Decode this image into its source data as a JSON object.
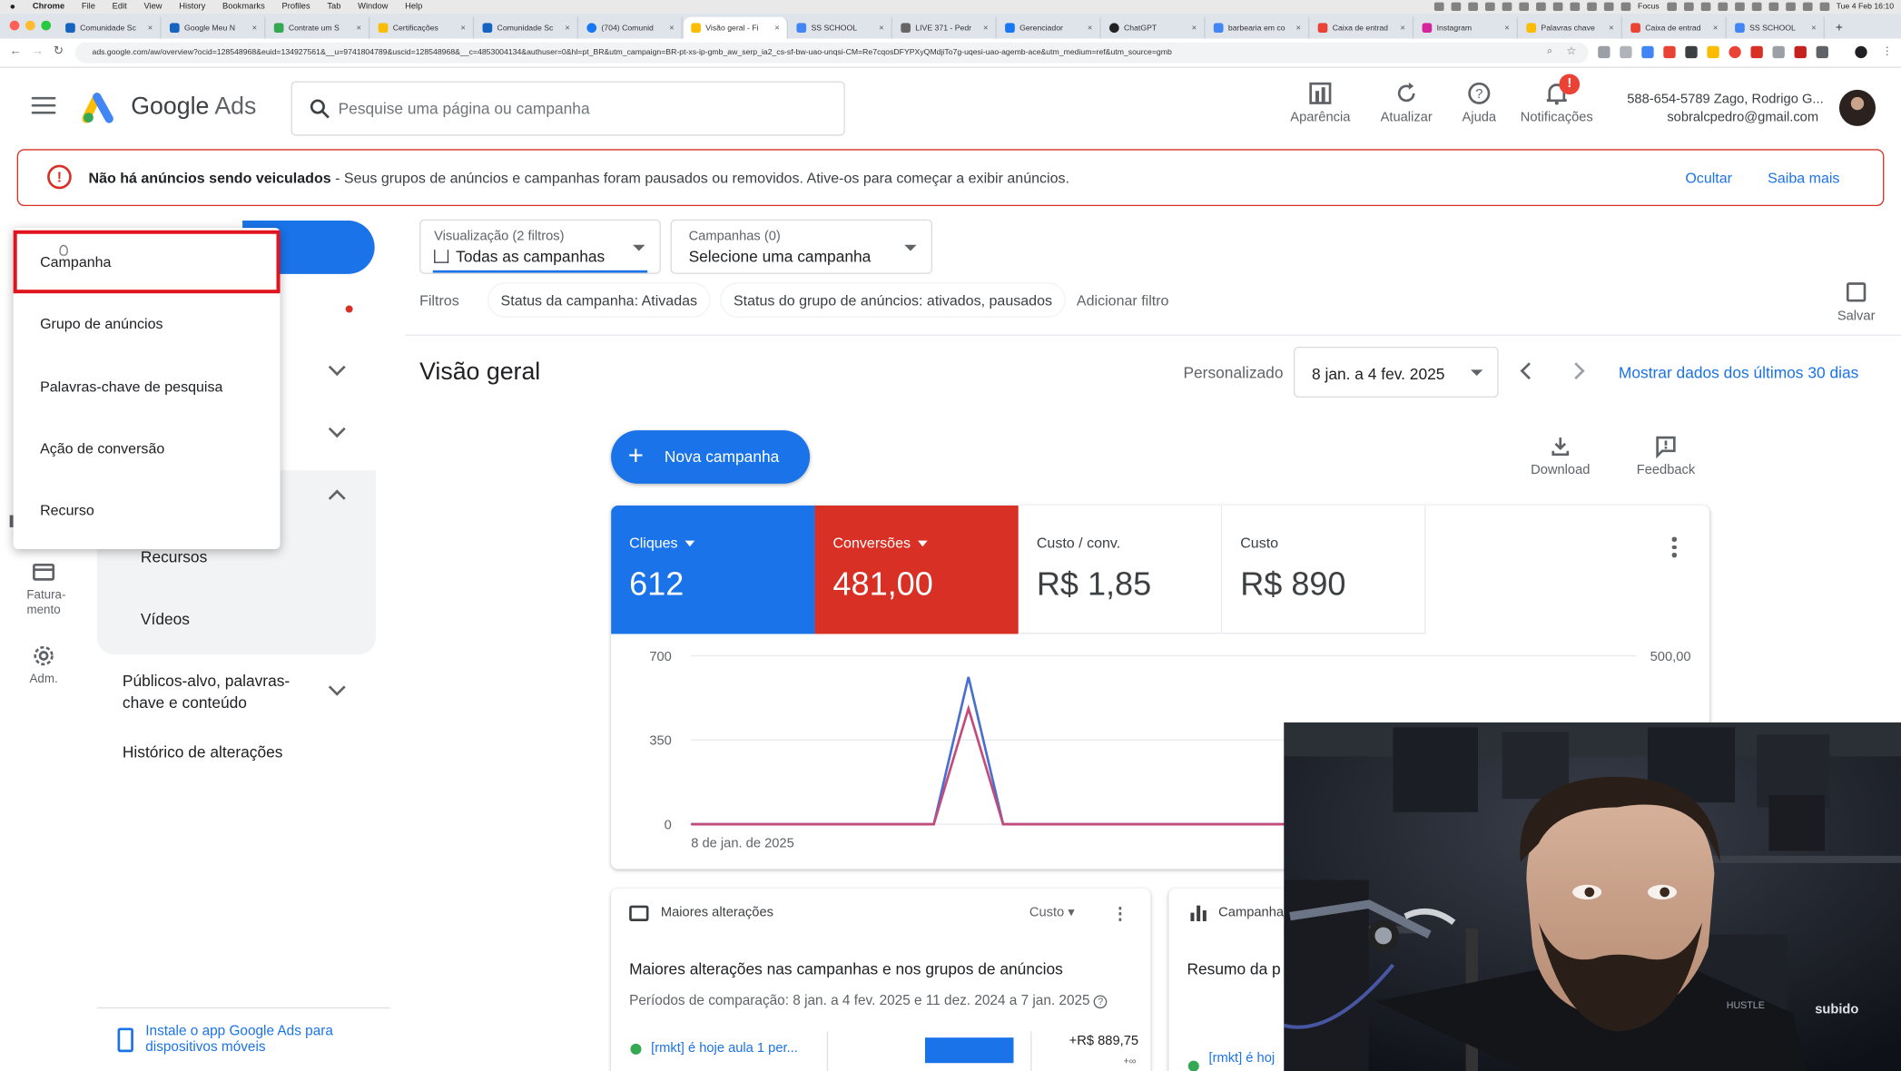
{
  "mac": {
    "menu": [
      "Chrome",
      "File",
      "Edit",
      "View",
      "History",
      "Bookmarks",
      "Profiles",
      "Tab",
      "Window",
      "Help"
    ],
    "right_items": [
      "Focus",
      "Tue 4 Feb 16:10"
    ]
  },
  "browser": {
    "tabs": [
      "Comunidade Sc",
      "Google Meu N",
      "Contrate um S",
      "Certificações",
      "Comunidade Sc",
      "(704) Comunid",
      "Visão geral - Fi",
      "SS SCHOOL",
      "LIVE 371 - Pedr",
      "Gerenciador",
      "ChatGPT",
      "barbearia em co",
      "Caixa de entrad",
      "Instagram",
      "Palavras chave",
      "Caixa de entrad",
      "SS SCHOOL"
    ],
    "url": "ads.google.com/aw/overview?ocid=128548968&euid=134927561&__u=9741804789&uscid=128548968&__c=4853004134&authuser=0&hl=pt_BR&utm_campaign=BR-pt-xs-ip-gmb_aw_serp_ia2_cs-sf-bw-uao-unqsi-CM=Re7cqosDFYPXyQMdjiTo7g-uqesi-uao-agemb-ace&utm_medium=ref&utm_source=gmb"
  },
  "header": {
    "brand_google": "Google",
    "brand_ads": "Ads",
    "search_placeholder": "Pesquise uma página ou campanha",
    "buttons": {
      "appearance": "Aparência",
      "refresh": "Atualizar",
      "help": "Ajuda",
      "notifications": "Notificações"
    },
    "notification_badge": "!",
    "account_line1": "588-654-5789 Zago, Rodrigo G...",
    "account_line2": "sobralcpedro@gmail.com"
  },
  "alert": {
    "icon": "!",
    "title": "Não há anúncios sendo veiculados",
    "message": " - Seus grupos de anúncios e campanhas foram pausados ou removidos. Ative-os para começar a exibir anúncios.",
    "hide": "Ocultar",
    "learn_more": "Saiba mais"
  },
  "dropdown_menu": {
    "items": [
      "Campanha",
      "Grupo de anúncios",
      "Palavras-chave de pesquisa",
      "Ação de conversão",
      "Recurso"
    ],
    "highlighted": "Campanha"
  },
  "sidebar": {
    "rail": {
      "billing": "Fatura-\nmento",
      "admin": "Adm."
    },
    "sub_items": [
      "Recursos",
      "Vídeos"
    ],
    "items": [
      "Públicos-alvo, palavras-\nchave e conteúdo",
      "Histórico de alterações"
    ],
    "app_link": "Instale o app Google Ads para dispositivos móveis"
  },
  "filters": {
    "view_label": "Visualização (2 filtros)",
    "view_value": "Todas as campanhas",
    "campaigns_label": "Campanhas (0)",
    "campaigns_value": "Selecione uma campanha",
    "filters_label": "Filtros",
    "chips": [
      "Status da campanha: Ativadas",
      "Status do grupo de anúncios: ativados, pausados"
    ],
    "add_filter": "Adicionar filtro",
    "save": "Salvar"
  },
  "overview": {
    "title": "Visão geral",
    "period_label": "Personalizado",
    "date_range": "8 jan. a 4 fev. 2025",
    "show_last": "Mostrar dados dos últimos 30 dias",
    "new_campaign": "Nova campanha",
    "download": "Download",
    "feedback": "Feedback"
  },
  "metrics": [
    {
      "label": "Cliques",
      "value": "612",
      "bg": "#1a73e8",
      "fg": "#ffffff"
    },
    {
      "label": "Conversões",
      "value": "481,00",
      "bg": "#d93025",
      "fg": "#ffffff"
    },
    {
      "label": "Custo / conv.",
      "value": "R$ 1,85",
      "bg": "#ffffff",
      "fg": "#3c4043"
    },
    {
      "label": "Custo",
      "value": "R$ 890",
      "bg": "#ffffff",
      "fg": "#3c4043"
    }
  ],
  "chart_data": {
    "type": "line",
    "x_label_first": "8 de jan. de 2025",
    "y_left_ticks": [
      "700",
      "350",
      "0"
    ],
    "y_right_ticks": [
      "500,00"
    ],
    "ylim_left": [
      0,
      700
    ],
    "ylim_right": [
      0,
      500
    ],
    "series": [
      {
        "name": "Cliques",
        "color": "#4a6fd0",
        "values": [
          0,
          0,
          0,
          0,
          0,
          0,
          0,
          0,
          612,
          0,
          0,
          0,
          0,
          0,
          0,
          0,
          0,
          0,
          0,
          0,
          0,
          0,
          0,
          0,
          0,
          0,
          0,
          0
        ]
      },
      {
        "name": "Conversões",
        "color": "#c24b7a",
        "values": [
          0,
          0,
          0,
          0,
          0,
          0,
          0,
          0,
          481,
          0,
          0,
          0,
          0,
          0,
          0,
          0,
          0,
          0,
          0,
          0,
          0,
          0,
          0,
          0,
          0,
          0,
          0,
          0
        ]
      }
    ]
  },
  "bottom_cards": {
    "changes": {
      "title": "Maiores alterações",
      "sort": "Custo",
      "heading": "Maiores alterações nas campanhas e nos grupos de anúncios",
      "periods": "Períodos de comparação: 8 jan. a 4 fev. 2025 e 11 dez. 2024 a 7 jan. 2025",
      "row_name": "[rmkt] é hoje aula 1 per...",
      "row_value": "+R$ 889,75",
      "row_sub": "+∞"
    },
    "campaigns": {
      "title": "Campanha",
      "heading": "Resumo da p",
      "row_name": "[rmkt] é hoj"
    }
  },
  "webcam": {
    "overlay_text": "subido",
    "poster_text": "HUSTLE"
  }
}
